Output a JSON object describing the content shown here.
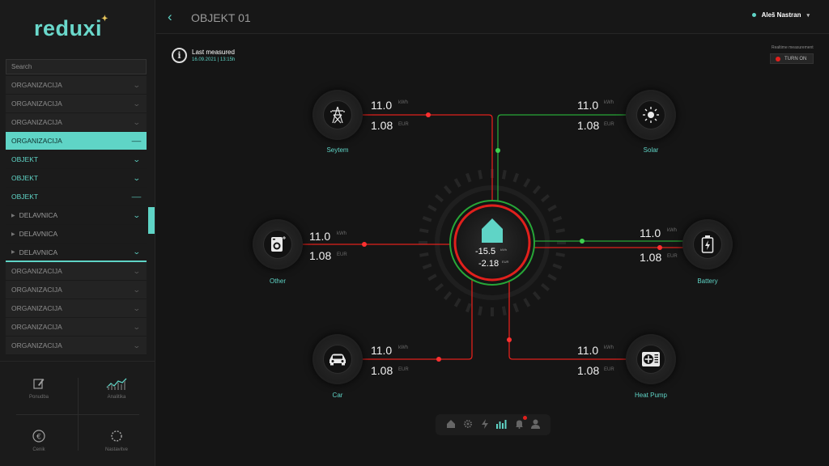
{
  "app": {
    "logo": "reduxi"
  },
  "header": {
    "title": "OBJEKT 01",
    "user": "Aleš Nastran"
  },
  "sidebar": {
    "search_placeholder": "Search",
    "tree": [
      {
        "label": "ORGANIZACIJA",
        "kind": "org",
        "expanded": false
      },
      {
        "label": "ORGANIZACIJA",
        "kind": "org",
        "expanded": false
      },
      {
        "label": "ORGANIZACIJA",
        "kind": "org",
        "expanded": false
      },
      {
        "label": "ORGANIZACIJA",
        "kind": "active",
        "expanded": true
      },
      {
        "label": "OBJEKT",
        "kind": "obj",
        "expanded": false
      },
      {
        "label": "OBJEKT",
        "kind": "obj",
        "expanded": false
      },
      {
        "label": "OBJEKT",
        "kind": "obj",
        "expanded": true
      },
      {
        "label": "DELAVNICA",
        "kind": "del",
        "expanded": false
      },
      {
        "label": "DELAVNICA",
        "kind": "del",
        "expanded": null
      },
      {
        "label": "DELAVNICA",
        "kind": "del",
        "expanded": false
      },
      {
        "label": "ORGANIZACIJA",
        "kind": "org",
        "expanded": false
      },
      {
        "label": "ORGANIZACIJA",
        "kind": "org",
        "expanded": false
      },
      {
        "label": "ORGANIZACIJA",
        "kind": "org",
        "expanded": false
      },
      {
        "label": "ORGANIZACIJA",
        "kind": "org",
        "expanded": false
      },
      {
        "label": "ORGANIZACIJA",
        "kind": "org",
        "expanded": false
      }
    ],
    "bottom_nav": [
      {
        "label": "Ponudba",
        "icon": "edit-icon"
      },
      {
        "label": "Analitika",
        "icon": "chart-icon"
      },
      {
        "label": "Cenik",
        "icon": "euro-icon"
      },
      {
        "label": "Nastavitve",
        "icon": "settings-icon"
      }
    ]
  },
  "status": {
    "last_measured_label": "Last measured",
    "last_measured_value": "16.09.2021 | 13:15h",
    "realtime_label": "Realtime measurement",
    "realtime_button": "TURN ON"
  },
  "center": {
    "value1": "-15.5",
    "unit1": "kWh",
    "value2": "-2.18",
    "unit2": "EUR"
  },
  "nodes": {
    "system": {
      "label": "Seytem",
      "energy": "11.0",
      "energy_unit": "kWh",
      "cost": "1.08",
      "cost_unit": "EUR"
    },
    "solar": {
      "label": "Solar",
      "energy": "11.0",
      "energy_unit": "kWh",
      "cost": "1.08",
      "cost_unit": "EUR"
    },
    "other": {
      "label": "Other",
      "energy": "11.0",
      "energy_unit": "kWh",
      "cost": "1.08",
      "cost_unit": "EUR"
    },
    "battery": {
      "label": "Battery",
      "energy": "11.0",
      "energy_unit": "kWh",
      "cost": "1.08",
      "cost_unit": "EUR"
    },
    "car": {
      "label": "Car",
      "energy": "11.0",
      "energy_unit": "kWh",
      "cost": "1.08",
      "cost_unit": "EUR"
    },
    "heatpump": {
      "label": "Heat Pump",
      "energy": "11.0",
      "energy_unit": "kWh",
      "cost": "1.08",
      "cost_unit": "EUR"
    }
  },
  "colors": {
    "accent": "#5fd4c6",
    "consume": "#e0201c",
    "produce": "#27a637"
  }
}
